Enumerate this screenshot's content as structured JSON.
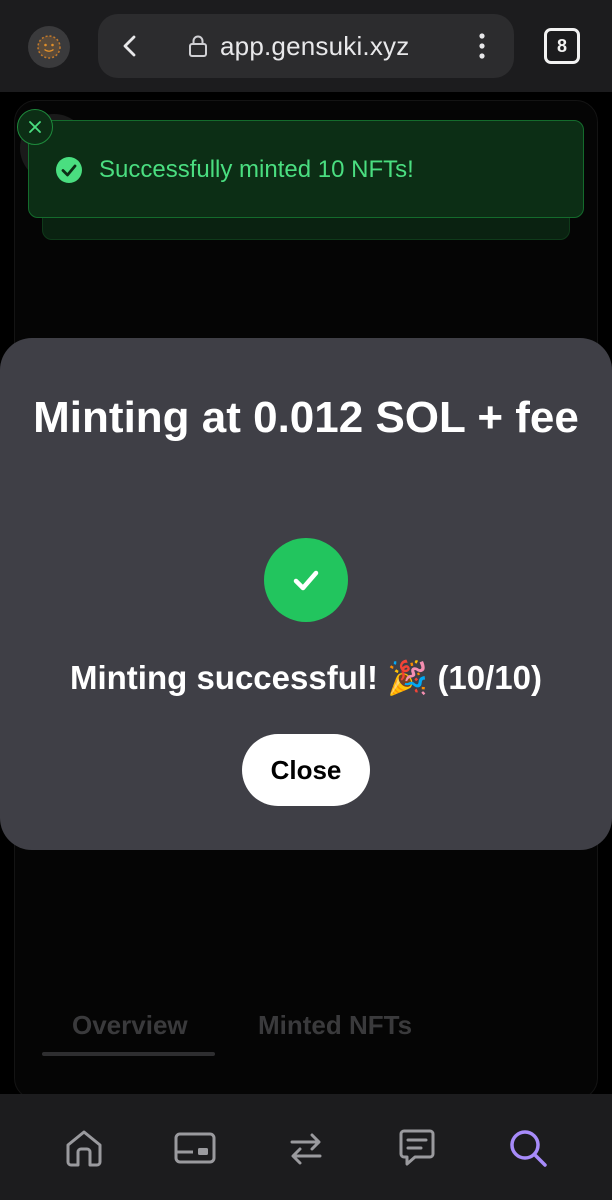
{
  "browser": {
    "url": "app.gensuki.xyz",
    "tab_count": "8"
  },
  "toast": {
    "message": "Successfully minted 10 NFTs!",
    "color": "#4ade80"
  },
  "modal": {
    "title": "Minting at 0.012 SOL + fee",
    "status_text": "Minting successful! 🎉 (10/10)",
    "close_label": "Close",
    "success_color": "#22c55e"
  },
  "tabs": [
    {
      "label": "Overview"
    },
    {
      "label": "Minted NFTs"
    }
  ],
  "bottom_nav": {
    "items": [
      "home-icon",
      "wallet-icon",
      "swap-icon",
      "chat-icon",
      "search-icon"
    ],
    "active": "search-icon",
    "active_color": "#a78bfa"
  }
}
